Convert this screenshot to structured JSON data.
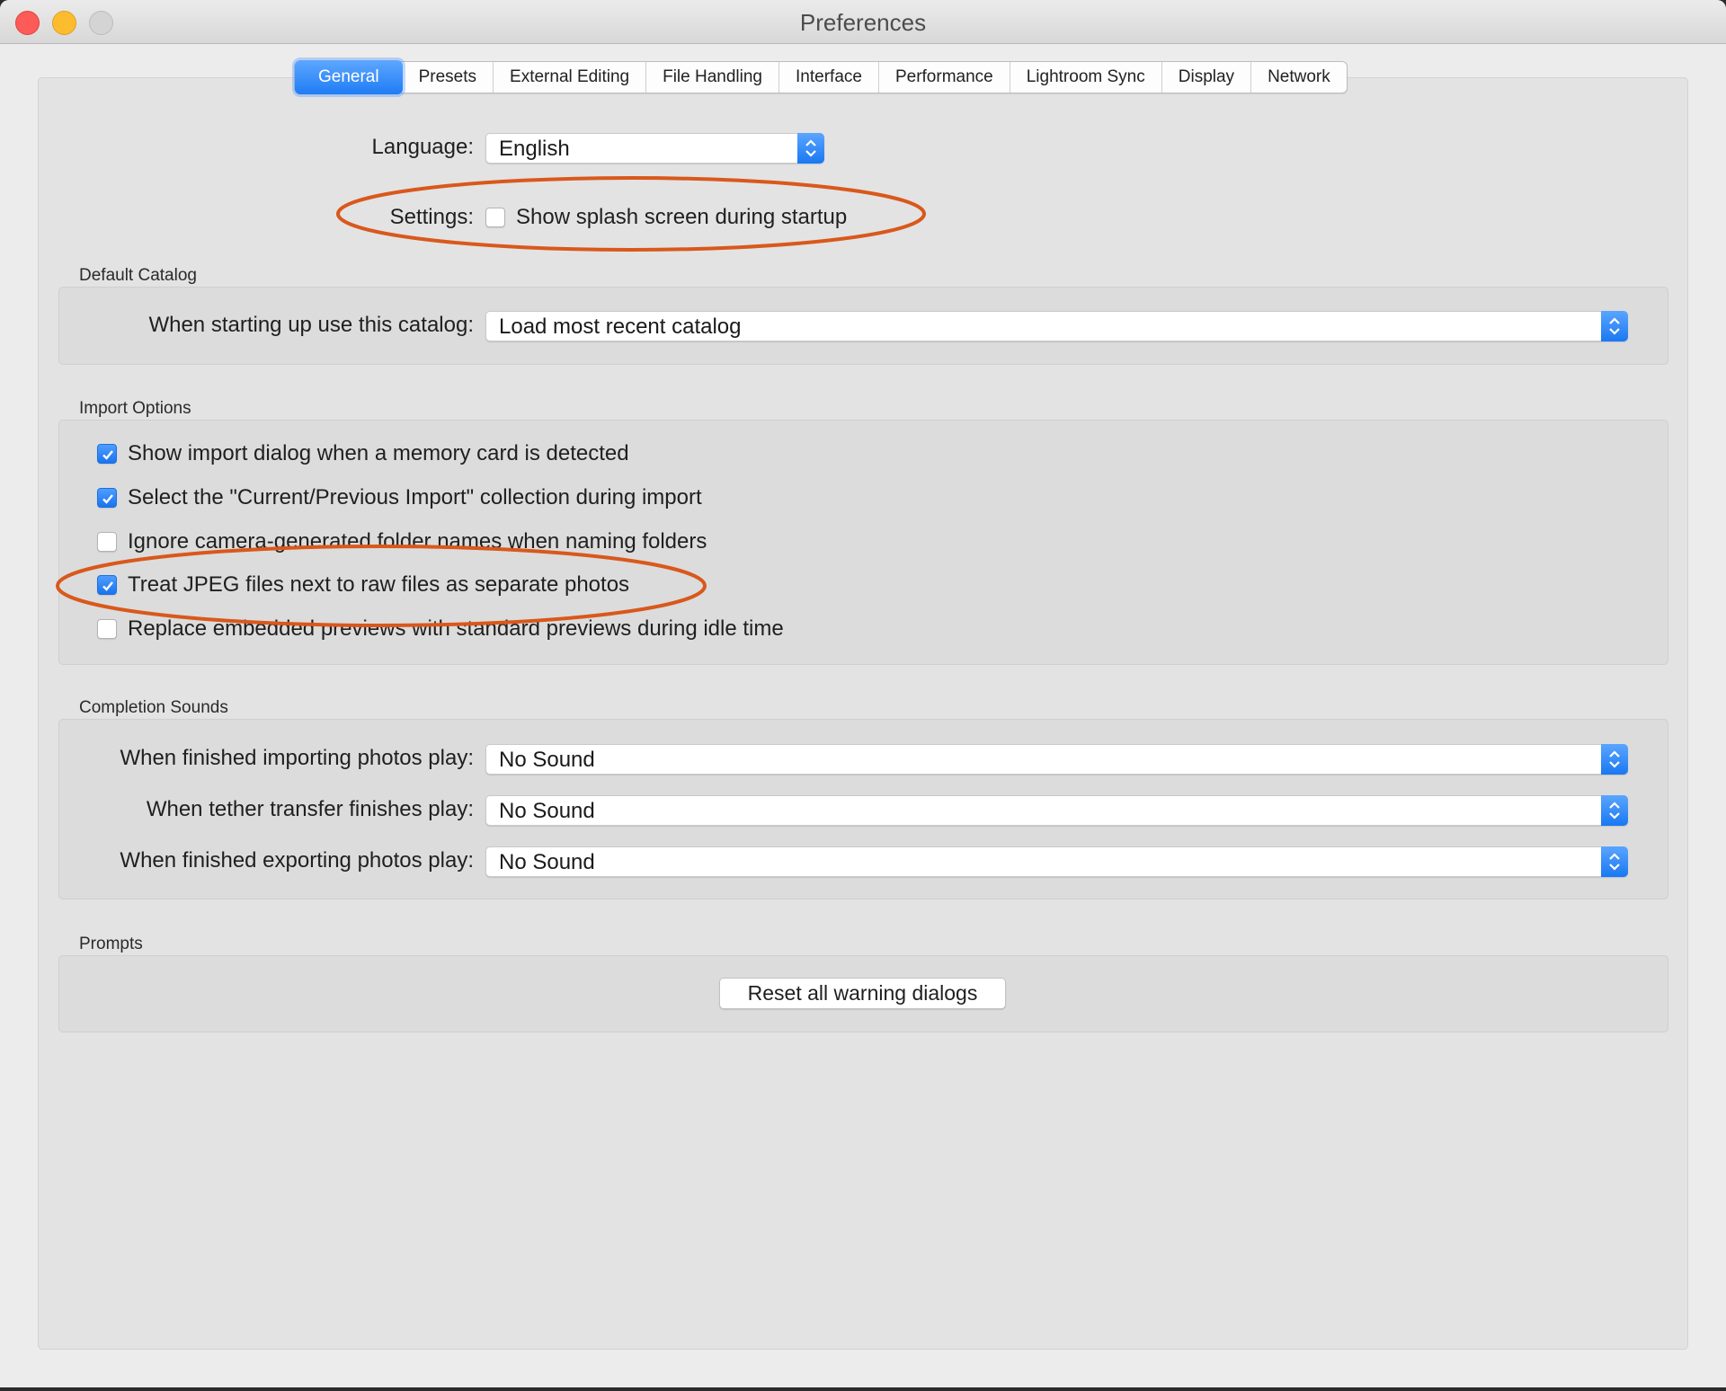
{
  "window": {
    "title": "Preferences"
  },
  "tabs": [
    {
      "label": "General",
      "active": true
    },
    {
      "label": "Presets"
    },
    {
      "label": "External Editing"
    },
    {
      "label": "File Handling"
    },
    {
      "label": "Interface"
    },
    {
      "label": "Performance"
    },
    {
      "label": "Lightroom Sync"
    },
    {
      "label": "Display"
    },
    {
      "label": "Network"
    }
  ],
  "general": {
    "language_label": "Language:",
    "language_value": "English",
    "settings_label": "Settings:",
    "splash_label": "Show splash screen during startup",
    "splash_checked": false
  },
  "default_catalog": {
    "title": "Default Catalog",
    "label": "When starting up use this catalog:",
    "value": "Load most recent catalog"
  },
  "import_options": {
    "title": "Import Options",
    "items": [
      {
        "label": "Show import dialog when a memory card is detected",
        "checked": true
      },
      {
        "label": "Select the \"Current/Previous Import\" collection during import",
        "checked": true
      },
      {
        "label": "Ignore camera-generated folder names when naming folders",
        "checked": false
      },
      {
        "label": "Treat JPEG files next to raw files as separate photos",
        "checked": true
      },
      {
        "label": "Replace embedded previews with standard previews during idle time",
        "checked": false
      }
    ]
  },
  "completion_sounds": {
    "title": "Completion Sounds",
    "rows": [
      {
        "label": "When finished importing photos play:",
        "value": "No Sound"
      },
      {
        "label": "When tether transfer finishes play:",
        "value": "No Sound"
      },
      {
        "label": "When finished exporting photos play:",
        "value": "No Sound"
      }
    ]
  },
  "prompts": {
    "title": "Prompts",
    "reset_label": "Reset all warning dialogs"
  },
  "colors": {
    "accent": "#1f7cf5",
    "annotation": "#d9581c"
  }
}
